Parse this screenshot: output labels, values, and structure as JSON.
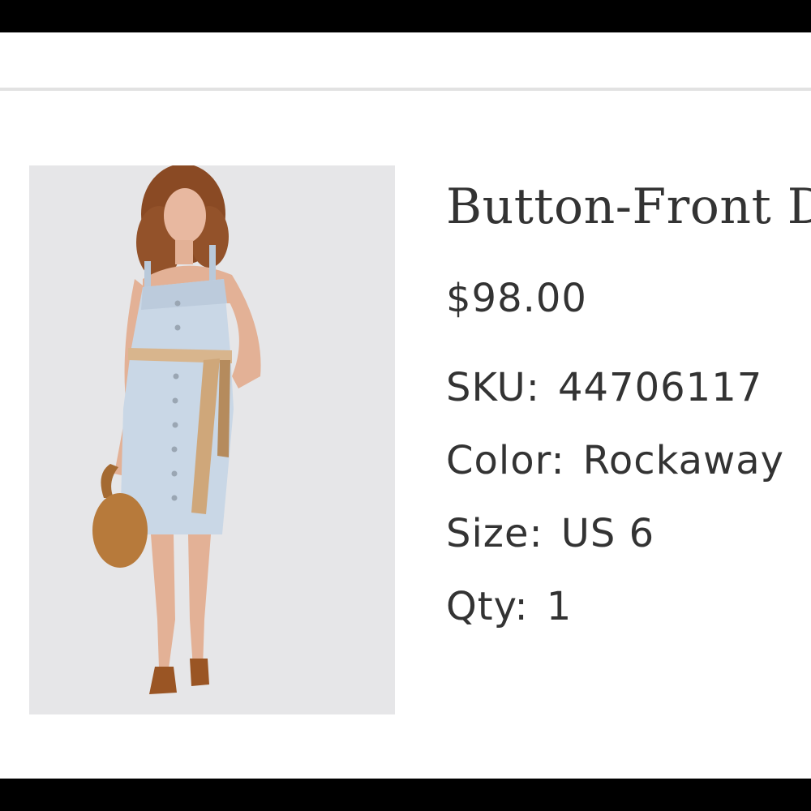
{
  "product": {
    "title": "Button-Front D",
    "price": "$98.00",
    "sku": {
      "label": "SKU:",
      "value": "44706117"
    },
    "color": {
      "label": "Color:",
      "value": "Rockaway"
    },
    "size": {
      "label": "Size:",
      "value": "US 6"
    },
    "qty": {
      "label": "Qty:",
      "value": "1"
    }
  },
  "colors": {
    "frame": "#000000",
    "background": "#ffffff",
    "text": "#333333",
    "divider": "#e2e2e2",
    "photo_background": "#e6e6e8",
    "denim": "#c9d7e6"
  }
}
